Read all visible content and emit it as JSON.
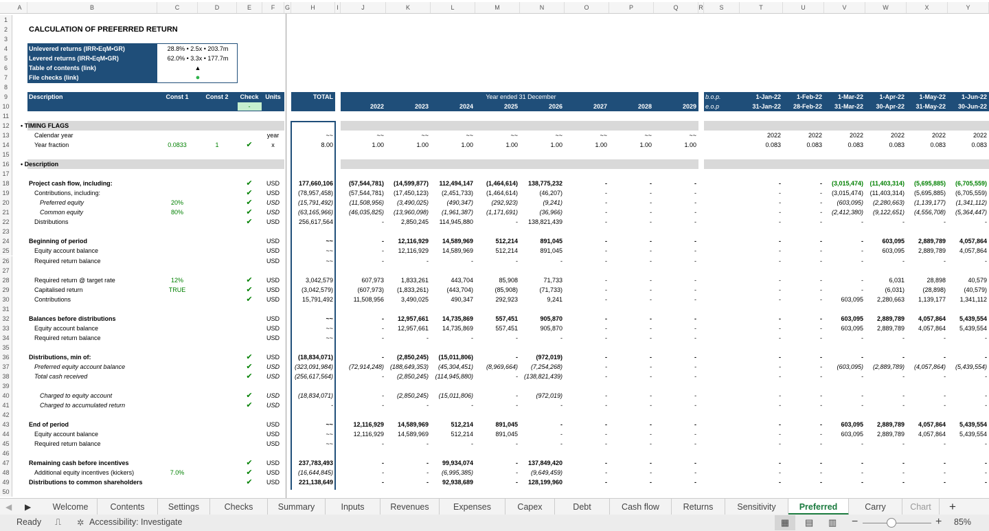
{
  "columns": [
    "A",
    "B",
    "C",
    "D",
    "E",
    "F",
    "G",
    "H",
    "I",
    "J",
    "K",
    "L",
    "M",
    "N",
    "O",
    "P",
    "Q",
    "R",
    "S",
    "T",
    "U",
    "V",
    "W",
    "X",
    "Y"
  ],
  "title": "CALCULATION OF PREFERRED RETURN",
  "summary": {
    "rows": [
      {
        "label": "Unlevered returns (IRR•EqM•GR)",
        "value": "28.8% • 2.5x • 203.7m"
      },
      {
        "label": "Levered returns (IRR•EqM•GR)",
        "value": "62.0% • 3.3x • 177.7m"
      },
      {
        "label": "Table of contents (link)",
        "value": "▲"
      },
      {
        "label": "File checks (link)",
        "value": "●"
      }
    ]
  },
  "header": {
    "description": "Description",
    "const1": "Const 1",
    "const2": "Const 2",
    "check": "Check",
    "units": "Units",
    "total": "TOTAL",
    "year_ended": "Year ended 31 December",
    "check_val": "-",
    "years": [
      "2022",
      "2023",
      "2024",
      "2025",
      "2026",
      "2027",
      "2028",
      "2029"
    ],
    "bop": "b.o.p.",
    "eop": "e.o.p",
    "month_start": [
      "1-Jan-22",
      "1-Feb-22",
      "1-Mar-22",
      "1-Apr-22",
      "1-May-22",
      "1-Jun-22"
    ],
    "month_end": [
      "31-Jan-22",
      "28-Feb-22",
      "31-Mar-22",
      "30-Apr-22",
      "31-May-22",
      "30-Jun-22"
    ]
  },
  "rows": [
    {
      "n": 12,
      "sec": true,
      "B": "• TIMING FLAGS"
    },
    {
      "n": 13,
      "B": "Calendar year",
      "ind": 1,
      "F": "year",
      "H": "~~",
      "y": [
        "~~",
        "~~",
        "~~",
        "~~",
        "~~",
        "~~",
        "~~",
        "~~"
      ],
      "m": [
        "2022",
        "2022",
        "2022",
        "2022",
        "2022",
        "2022"
      ]
    },
    {
      "n": 14,
      "B": "Year fraction",
      "ind": 1,
      "C": "0.0833",
      "D": "1",
      "E": "✔",
      "F": "x",
      "H": "8.00",
      "y": [
        "1.00",
        "1.00",
        "1.00",
        "1.00",
        "1.00",
        "1.00",
        "1.00",
        "1.00"
      ],
      "m": [
        "0.083",
        "0.083",
        "0.083",
        "0.083",
        "0.083",
        "0.083"
      ]
    },
    {
      "n": 16,
      "sec": true,
      "B": "• Description"
    },
    {
      "n": 18,
      "B": "Project cash flow, including:",
      "bold": true,
      "E": "✔",
      "F": "USD",
      "H": "177,660,106",
      "y": [
        "(57,544,781)",
        "(14,599,877)",
        "112,494,147",
        "(1,464,614)",
        "138,775,232",
        "-",
        "-",
        "-"
      ],
      "m": [
        "-",
        "-",
        "(3,015,474)",
        "(11,403,314)",
        "(5,695,885)",
        "(6,705,559)"
      ],
      "mg": true
    },
    {
      "n": 19,
      "B": "Contributions, including:",
      "ind": 1,
      "E": "✔",
      "F": "USD",
      "H": "(78,957,458)",
      "y": [
        "(57,544,781)",
        "(17,450,123)",
        "(2,451,733)",
        "(1,464,614)",
        "(46,207)",
        "-",
        "-",
        "-"
      ],
      "m": [
        "-",
        "-",
        "(3,015,474)",
        "(11,403,314)",
        "(5,695,885)",
        "(6,705,559)"
      ]
    },
    {
      "n": 20,
      "B": "Preferred equity",
      "ind": 2,
      "it": true,
      "C": "20%",
      "E": "✔",
      "F": "USD",
      "H": "(15,791,492)",
      "y": [
        "(11,508,956)",
        "(3,490,025)",
        "(490,347)",
        "(292,923)",
        "(9,241)",
        "-",
        "-",
        "-"
      ],
      "m": [
        "-",
        "-",
        "(603,095)",
        "(2,280,663)",
        "(1,139,177)",
        "(1,341,112)"
      ]
    },
    {
      "n": 21,
      "B": "Common equity",
      "ind": 2,
      "it": true,
      "C": "80%",
      "E": "✔",
      "F": "USD",
      "H": "(63,165,966)",
      "y": [
        "(46,035,825)",
        "(13,960,098)",
        "(1,961,387)",
        "(1,171,691)",
        "(36,966)",
        "-",
        "-",
        "-"
      ],
      "m": [
        "-",
        "-",
        "(2,412,380)",
        "(9,122,651)",
        "(4,556,708)",
        "(5,364,447)"
      ]
    },
    {
      "n": 22,
      "B": "Distributions",
      "ind": 1,
      "E": "✔",
      "F": "USD",
      "H": "256,617,564",
      "y": [
        "-",
        "2,850,245",
        "114,945,880",
        "-",
        "138,821,439",
        "-",
        "-",
        "-"
      ],
      "m": [
        "-",
        "-",
        "-",
        "-",
        "-",
        "-"
      ]
    },
    {
      "n": 24,
      "B": "Beginning of period",
      "bold": true,
      "F": "USD",
      "H": "~~",
      "y": [
        "-",
        "12,116,929",
        "14,589,969",
        "512,214",
        "891,045",
        "-",
        "-",
        "-"
      ],
      "m": [
        "-",
        "-",
        "-",
        "603,095",
        "2,889,789",
        "4,057,864"
      ]
    },
    {
      "n": 25,
      "B": "Equity account balance",
      "ind": 1,
      "F": "USD",
      "H": "~~",
      "y": [
        "-",
        "12,116,929",
        "14,589,969",
        "512,214",
        "891,045",
        "-",
        "-",
        "-"
      ],
      "m": [
        "-",
        "-",
        "-",
        "603,095",
        "2,889,789",
        "4,057,864"
      ]
    },
    {
      "n": 26,
      "B": "Required return balance",
      "ind": 1,
      "F": "USD",
      "H": "~~",
      "y": [
        "-",
        "-",
        "-",
        "-",
        "-",
        "-",
        "-",
        "-"
      ],
      "m": [
        "-",
        "-",
        "-",
        "-",
        "-",
        "-"
      ]
    },
    {
      "n": 28,
      "B": "Required return @ target rate",
      "ind": 1,
      "C": "12%",
      "E": "✔",
      "F": "USD",
      "H": "3,042,579",
      "y": [
        "607,973",
        "1,833,261",
        "443,704",
        "85,908",
        "71,733",
        "-",
        "-",
        "-"
      ],
      "m": [
        "-",
        "-",
        "-",
        "6,031",
        "28,898",
        "40,579"
      ]
    },
    {
      "n": 29,
      "B": "Capitalised return",
      "ind": 1,
      "C": "TRUE",
      "E": "✔",
      "F": "USD",
      "H": "(3,042,579)",
      "y": [
        "(607,973)",
        "(1,833,261)",
        "(443,704)",
        "(85,908)",
        "(71,733)",
        "-",
        "-",
        "-"
      ],
      "m": [
        "-",
        "-",
        "-",
        "(6,031)",
        "(28,898)",
        "(40,579)"
      ]
    },
    {
      "n": 30,
      "B": "Contributions",
      "ind": 1,
      "E": "✔",
      "F": "USD",
      "H": "15,791,492",
      "y": [
        "11,508,956",
        "3,490,025",
        "490,347",
        "292,923",
        "9,241",
        "-",
        "-",
        "-"
      ],
      "m": [
        "-",
        "-",
        "603,095",
        "2,280,663",
        "1,139,177",
        "1,341,112"
      ]
    },
    {
      "n": 32,
      "B": "Balances before distributions",
      "bold": true,
      "F": "USD",
      "H": "~~",
      "y": [
        "-",
        "12,957,661",
        "14,735,869",
        "557,451",
        "905,870",
        "-",
        "-",
        "-"
      ],
      "m": [
        "-",
        "-",
        "603,095",
        "2,889,789",
        "4,057,864",
        "5,439,554"
      ]
    },
    {
      "n": 33,
      "B": "Equity account balance",
      "ind": 1,
      "F": "USD",
      "H": "~~",
      "y": [
        "-",
        "12,957,661",
        "14,735,869",
        "557,451",
        "905,870",
        "-",
        "-",
        "-"
      ],
      "m": [
        "-",
        "-",
        "603,095",
        "2,889,789",
        "4,057,864",
        "5,439,554"
      ]
    },
    {
      "n": 34,
      "B": "Required return balance",
      "ind": 1,
      "F": "USD",
      "H": "~~",
      "y": [
        "-",
        "-",
        "-",
        "-",
        "-",
        "-",
        "-",
        "-"
      ],
      "m": [
        "-",
        "-",
        "-",
        "-",
        "-",
        "-"
      ]
    },
    {
      "n": 36,
      "B": "Distributions, min of:",
      "bold": true,
      "E": "✔",
      "F": "USD",
      "H": "(18,834,071)",
      "y": [
        "-",
        "(2,850,245)",
        "(15,011,806)",
        "-",
        "(972,019)",
        "-",
        "-",
        "-"
      ],
      "m": [
        "-",
        "-",
        "-",
        "-",
        "-",
        "-"
      ]
    },
    {
      "n": 37,
      "B": "Preferred equity account balance",
      "ind": 1,
      "it": true,
      "E": "✔",
      "F": "USD",
      "H": "(323,091,984)",
      "y": [
        "(72,914,248)",
        "(188,649,353)",
        "(45,304,451)",
        "(8,969,664)",
        "(7,254,268)",
        "-",
        "-",
        "-"
      ],
      "m": [
        "-",
        "-",
        "(603,095)",
        "(2,889,789)",
        "(4,057,864)",
        "(5,439,554)"
      ]
    },
    {
      "n": 38,
      "B": "Total cash received",
      "ind": 1,
      "it": true,
      "E": "✔",
      "F": "USD",
      "H": "(256,617,564)",
      "y": [
        "-",
        "(2,850,245)",
        "(114,945,880)",
        "-",
        "(138,821,439)",
        "-",
        "-",
        "-"
      ],
      "m": [
        "-",
        "-",
        "-",
        "-",
        "-",
        "-"
      ]
    },
    {
      "n": 40,
      "B": "Charged to equity account",
      "ind": 2,
      "it": true,
      "E": "✔",
      "F": "USD",
      "H": "(18,834,071)",
      "y": [
        "-",
        "(2,850,245)",
        "(15,011,806)",
        "-",
        "(972,019)",
        "-",
        "-",
        "-"
      ],
      "m": [
        "-",
        "-",
        "-",
        "-",
        "-",
        "-"
      ]
    },
    {
      "n": 41,
      "B": "Charged to accumulated return",
      "ind": 2,
      "it": true,
      "E": "✔",
      "F": "USD",
      "H": "-",
      "y": [
        "-",
        "-",
        "-",
        "-",
        "-",
        "-",
        "-",
        "-"
      ],
      "m": [
        "-",
        "-",
        "-",
        "-",
        "-",
        "-"
      ]
    },
    {
      "n": 43,
      "B": "End of period",
      "bold": true,
      "F": "USD",
      "H": "~~",
      "y": [
        "12,116,929",
        "14,589,969",
        "512,214",
        "891,045",
        "-",
        "-",
        "-",
        "-"
      ],
      "m": [
        "-",
        "-",
        "603,095",
        "2,889,789",
        "4,057,864",
        "5,439,554"
      ]
    },
    {
      "n": 44,
      "B": "Equity account balance",
      "ind": 1,
      "F": "USD",
      "H": "~~",
      "y": [
        "12,116,929",
        "14,589,969",
        "512,214",
        "891,045",
        "-",
        "-",
        "-",
        "-"
      ],
      "m": [
        "-",
        "-",
        "603,095",
        "2,889,789",
        "4,057,864",
        "5,439,554"
      ]
    },
    {
      "n": 45,
      "B": "Required return balance",
      "ind": 1,
      "F": "USD",
      "H": "~~",
      "y": [
        "-",
        "-",
        "-",
        "-",
        "-",
        "-",
        "-",
        "-"
      ],
      "m": [
        "-",
        "-",
        "-",
        "-",
        "-",
        "-"
      ]
    },
    {
      "n": 47,
      "B": "Remaining cash before incentives",
      "bold": true,
      "E": "✔",
      "F": "USD",
      "H": "237,783,493",
      "y": [
        "-",
        "-",
        "99,934,074",
        "-",
        "137,849,420",
        "-",
        "-",
        "-"
      ],
      "m": [
        "-",
        "-",
        "-",
        "-",
        "-",
        "-"
      ]
    },
    {
      "n": 48,
      "B": "Additional equity incentives (kickers)",
      "ind": 1,
      "C": "7.0%",
      "E": "✔",
      "F": "USD",
      "H": "(16,644,845)",
      "hi": true,
      "y": [
        "-",
        "-",
        "(6,995,385)",
        "-",
        "(9,649,459)",
        "-",
        "-",
        "-"
      ],
      "yi": true,
      "m": [
        "-",
        "-",
        "-",
        "-",
        "-",
        "-"
      ]
    },
    {
      "n": 49,
      "B": "Distributions to common shareholders",
      "bold": true,
      "E": "✔",
      "F": "USD",
      "H": "221,138,649",
      "y": [
        "-",
        "-",
        "92,938,689",
        "-",
        "128,199,960",
        "-",
        "-",
        "-"
      ],
      "m": [
        "-",
        "-",
        "-",
        "-",
        "-",
        "-"
      ]
    }
  ],
  "tabs": [
    "Welcome",
    "Contents",
    "Settings",
    "Checks",
    "Summary",
    "Inputs",
    "Revenues",
    "Expenses",
    "Capex",
    "Debt",
    "Cash flow",
    "Returns",
    "Sensitivity",
    "Preferred",
    "Carry",
    "Chart"
  ],
  "active_tab": "Preferred",
  "status": {
    "ready": "Ready",
    "accessibility": "Accessibility: Investigate",
    "zoom": "85%"
  },
  "colors": {
    "header_blue": "#1f4e79",
    "check_green": "#008000",
    "section_grey": "#d9d9d9",
    "tab_active": "#1a7a3e"
  }
}
